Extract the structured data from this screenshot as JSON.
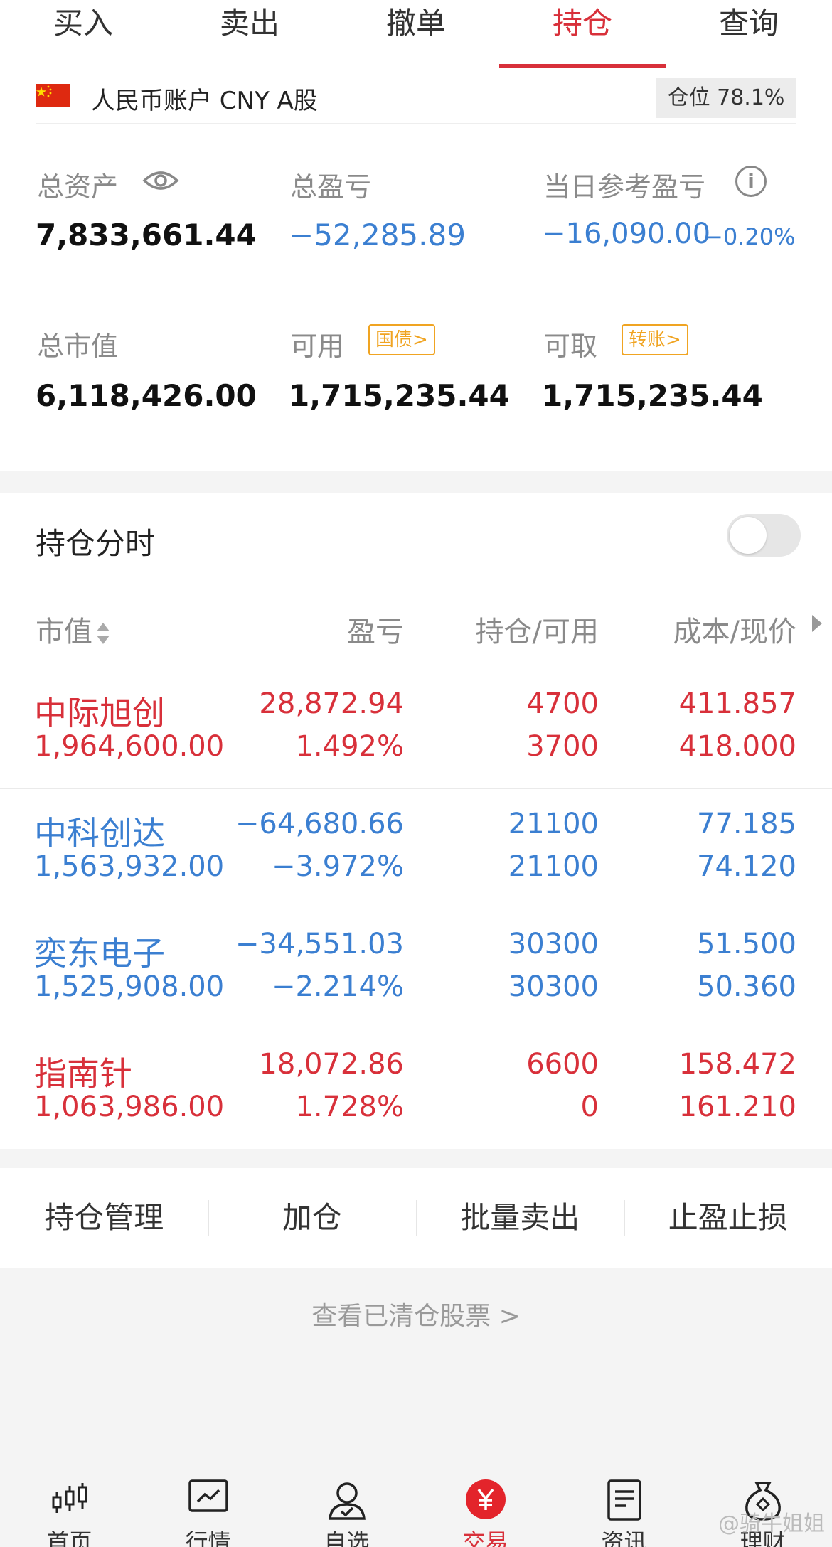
{
  "tabs": [
    "买入",
    "卖出",
    "撤单",
    "持仓",
    "查询"
  ],
  "account": {
    "name": "人民币账户 CNY A股",
    "position_label": "仓位 78.1%",
    "position_ratio": 0.781
  },
  "stats": {
    "total_assets_label": "总资产",
    "total_assets": "7,833,661.44",
    "total_pl_label": "总盈亏",
    "total_pl": "−52,285.89",
    "daily_pl_label": "当日参考盈亏",
    "daily_pl": "−16,090.00",
    "daily_pl_pct": "−0.20%",
    "market_value_label": "总市值",
    "market_value": "6,118,426.00",
    "available_label": "可用",
    "available_tag": "国债>",
    "available": "1,715,235.44",
    "withdrawable_label": "可取",
    "withdrawable_tag": "转账>",
    "withdrawable": "1,715,235.44"
  },
  "holdings": {
    "title": "持仓分时",
    "toggle_on": false,
    "columns": [
      "市值",
      "盈亏",
      "持仓/可用",
      "成本/现价"
    ],
    "rows": [
      {
        "name": "中际旭创",
        "market_value": "1,964,600.00",
        "pl": "28,872.94",
        "pl_pct": "1.492%",
        "hold": "4700",
        "avail": "3700",
        "cost": "411.857",
        "price": "418.000",
        "color": "#d8303a"
      },
      {
        "name": "中科创达",
        "market_value": "1,563,932.00",
        "pl": "−64,680.66",
        "pl_pct": "−3.972%",
        "hold": "21100",
        "avail": "21100",
        "cost": "77.185",
        "price": "74.120",
        "color": "#3b7fd1"
      },
      {
        "name": "奕东电子",
        "market_value": "1,525,908.00",
        "pl": "−34,551.03",
        "pl_pct": "−2.214%",
        "hold": "30300",
        "avail": "30300",
        "cost": "51.500",
        "price": "50.360",
        "color": "#3b7fd1"
      },
      {
        "name": "指南针",
        "market_value": "1,063,986.00",
        "pl": "18,072.86",
        "pl_pct": "1.728%",
        "hold": "6600",
        "avail": "0",
        "cost": "158.472",
        "price": "161.210",
        "color": "#d8303a"
      }
    ]
  },
  "actions": [
    "持仓管理",
    "加仓",
    "批量卖出",
    "止盈止损"
  ],
  "cleared_link": "查看已清仓股票 >",
  "bottom_nav": [
    "首页",
    "行情",
    "自选",
    "交易",
    "资讯",
    "理财"
  ],
  "watermark": "@骑牛姐姐",
  "colors": {
    "accent": "#d8303a",
    "down": "#3b7fd1",
    "tag": "#f0a422"
  }
}
